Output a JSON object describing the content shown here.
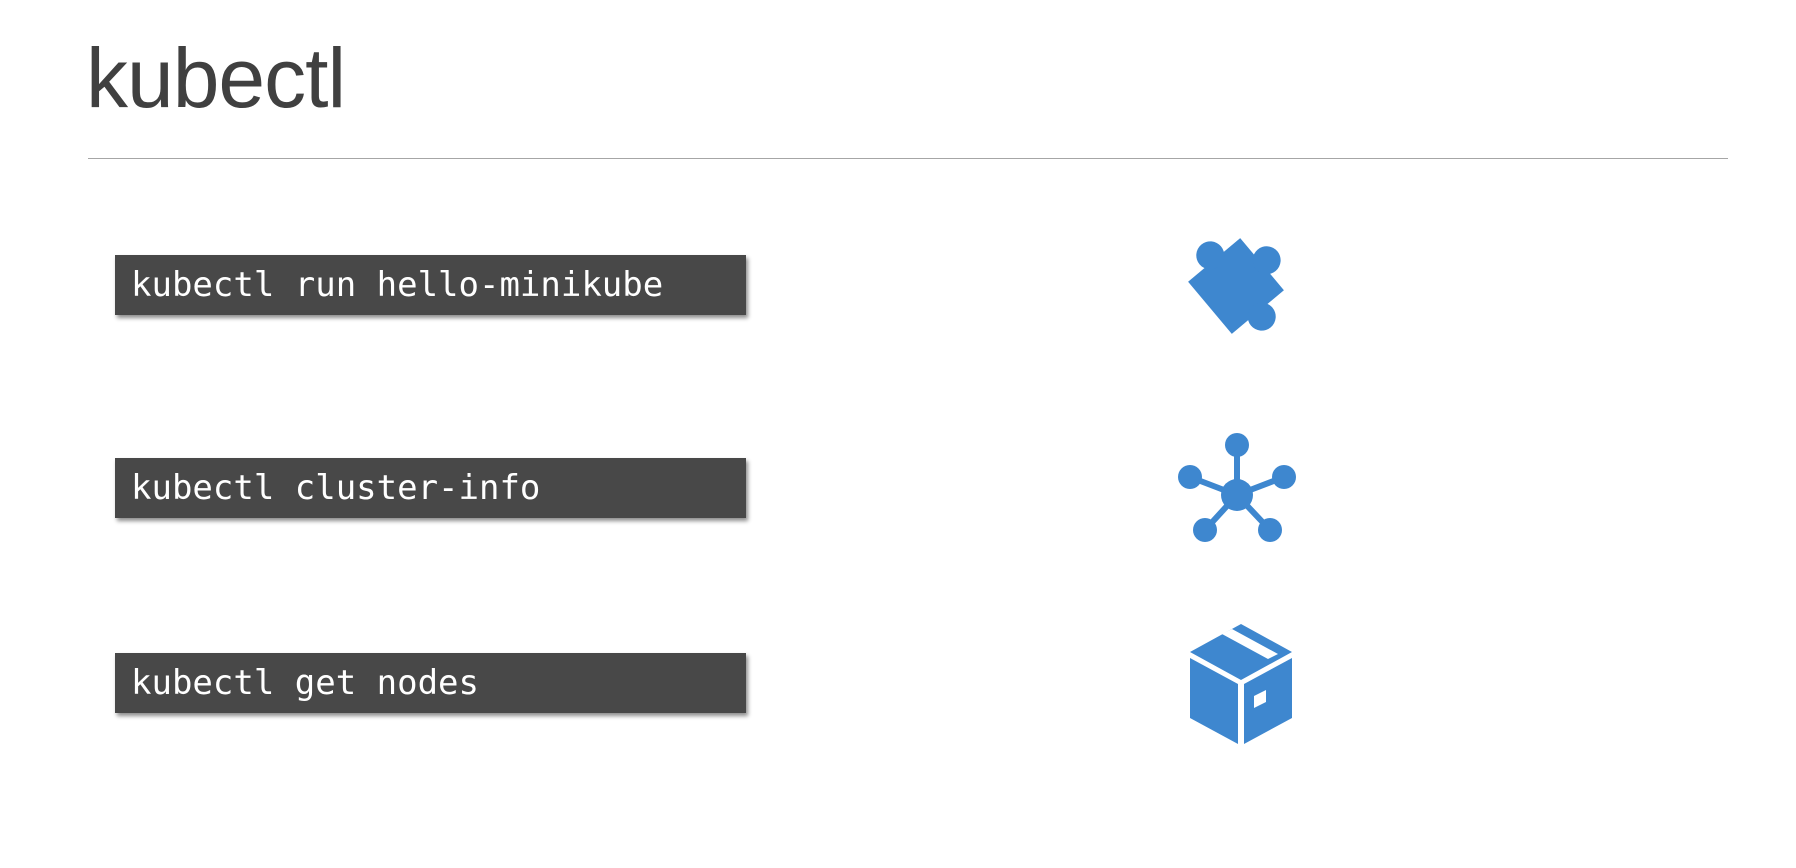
{
  "slide": {
    "title": "kubectl"
  },
  "commands": [
    {
      "text": "kubectl run hello-minikube",
      "icon": "puzzle-piece-icon"
    },
    {
      "text": "kubectl cluster-info",
      "icon": "network-hub-icon"
    },
    {
      "text": "kubectl get nodes",
      "icon": "package-box-icon"
    }
  ],
  "colors": {
    "accent": "#3e87cf",
    "command_bg": "#484848",
    "command_text": "#ffffff",
    "title": "#404040"
  }
}
